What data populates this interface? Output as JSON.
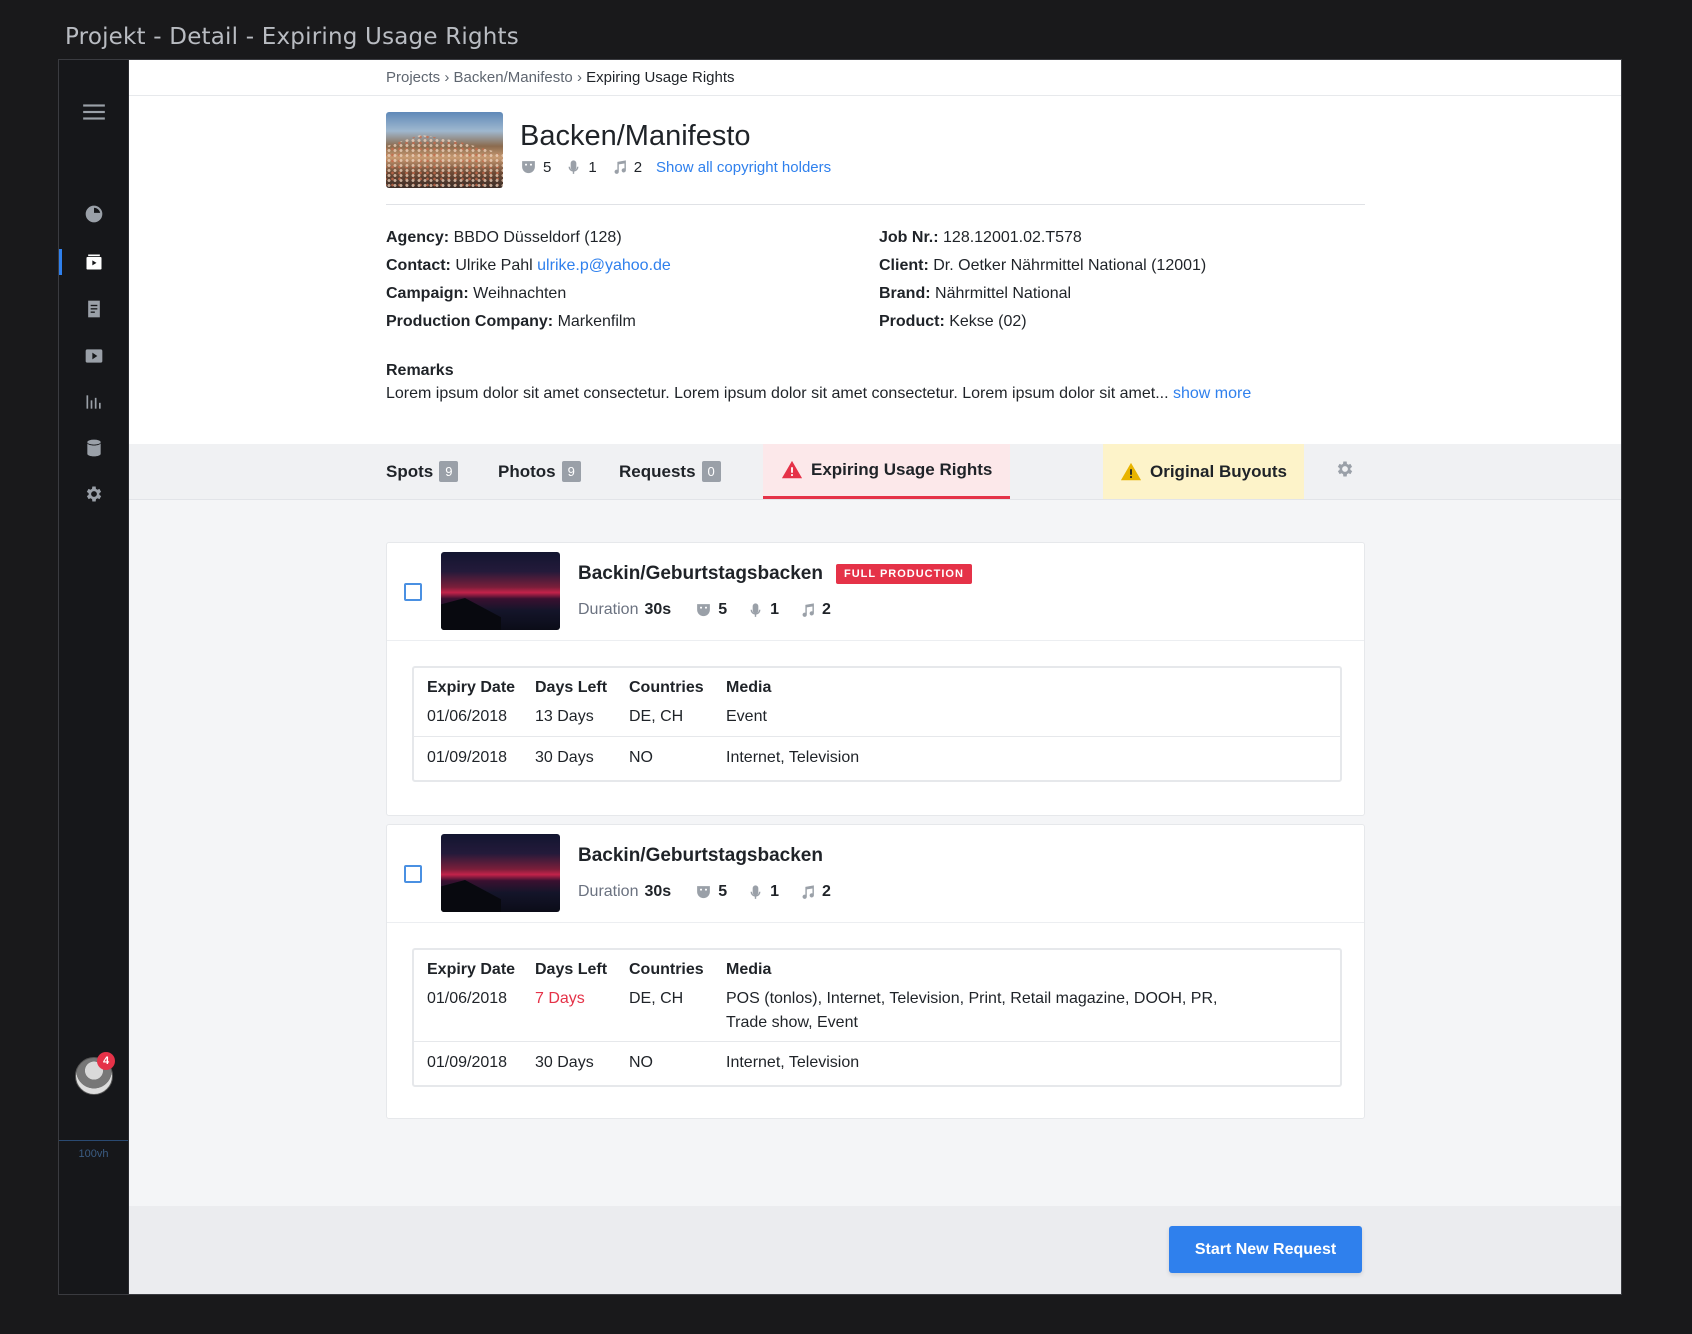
{
  "window": {
    "title": "Projekt - Detail - Expiring Usage Rights"
  },
  "sidebar": {
    "items": [
      "menu-icon",
      "dashboard-icon",
      "projects-icon",
      "documents-icon",
      "video-icon",
      "analytics-icon",
      "database-icon",
      "settings-icon"
    ],
    "active": "projects-icon",
    "notification_count": "4",
    "viewport_label": "100vh"
  },
  "breadcrumb": {
    "items": [
      "Projects",
      "Backen/Manifesto"
    ],
    "current": "Expiring Usage Rights",
    "separator": "›"
  },
  "project": {
    "title": "Backen/Manifesto",
    "stats": {
      "actors": "5",
      "voices": "1",
      "music": "2"
    },
    "show_holders_link": "Show all copyright holders"
  },
  "details": {
    "agency_label": "Agency:",
    "agency": "BBDO Düsseldorf (128)",
    "contact_label": "Contact:",
    "contact": "Ulrike Pahl",
    "contact_email": "ulrike.p@yahoo.de",
    "campaign_label": "Campaign:",
    "campaign": "Weihnachten",
    "production_label": "Production Company:",
    "production": "Markenfilm",
    "job_label": "Job Nr.:",
    "job": "128.12001.02.T578",
    "client_label": "Client:",
    "client": "Dr. Oetker Nährmittel National (12001)",
    "brand_label": "Brand:",
    "brand": "Nährmittel National",
    "product_label": "Product:",
    "product": "Kekse (02)"
  },
  "remarks": {
    "heading": "Remarks",
    "text": "Lorem ipsum dolor sit amet consectetur. Lorem ipsum dolor sit amet consectetur. Lorem ipsum dolor sit amet...",
    "show_more": "show more"
  },
  "tabs": {
    "spots": {
      "label": "Spots",
      "count": "9"
    },
    "photos": {
      "label": "Photos",
      "count": "9"
    },
    "requests": {
      "label": "Requests",
      "count": "0"
    },
    "expiring": {
      "label": "Expiring Usage Rights"
    },
    "buyouts": {
      "label": "Original Buyouts"
    }
  },
  "table_headers": {
    "expiry": "Expiry Date",
    "days": "Days Left",
    "countries": "Countries",
    "media": "Media"
  },
  "spots": [
    {
      "title": "Backin/Geburtstagsbacken",
      "badge": "FULL PRODUCTION",
      "duration_label": "Duration",
      "duration": "30s",
      "actors": "5",
      "voices": "1",
      "music": "2",
      "rows": [
        {
          "expiry": "01/06/2018",
          "days": "13 Days",
          "countries": "DE, CH",
          "media": "Event"
        },
        {
          "expiry": "01/09/2018",
          "days": "30 Days",
          "countries": "NO",
          "media": "Internet, Television"
        }
      ]
    },
    {
      "title": "Backin/Geburtstagsbacken",
      "duration_label": "Duration",
      "duration": "30s",
      "actors": "5",
      "voices": "1",
      "music": "2",
      "rows": [
        {
          "expiry": "01/06/2018",
          "days": "7 Days",
          "countries": "DE, CH",
          "media": "POS (tonlos), Internet, Television, Print, Retail magazine, DOOH, PR,",
          "media_line2": "Trade show, Event"
        },
        {
          "expiry": "01/09/2018",
          "days": "30 Days",
          "countries": "NO",
          "media": "Internet, Television"
        }
      ]
    }
  ],
  "footer": {
    "button": "Start New Request"
  },
  "colors": {
    "accent": "#2f80ed",
    "danger": "#e53248",
    "warning": "#f2c200"
  }
}
